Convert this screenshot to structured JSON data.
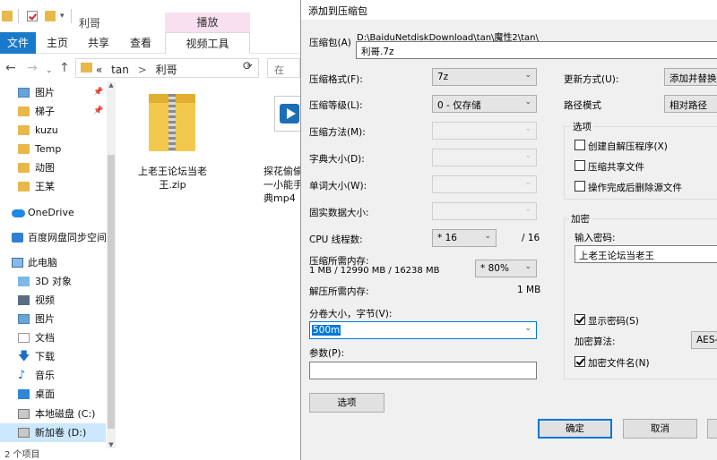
{
  "explorer": {
    "window_title": "利哥",
    "context_tab": "播放",
    "ribbon_tabs": [
      "文件",
      "主页",
      "共享",
      "查看",
      "视频工具"
    ],
    "address": {
      "prefix": "«",
      "segments": [
        "tan",
        "利哥"
      ],
      "separator": ">"
    },
    "search_placeholder": "在",
    "sidebar": {
      "quick_access": [
        {
          "label": "图片",
          "icon": "picture-icon",
          "pinned": true
        },
        {
          "label": "梯子",
          "icon": "folder-icon",
          "pinned": true
        },
        {
          "label": "kuzu",
          "icon": "folder-icon"
        },
        {
          "label": "Temp",
          "icon": "folder-icon"
        },
        {
          "label": "动图",
          "icon": "folder-icon"
        },
        {
          "label": "王某",
          "icon": "folder-icon"
        }
      ],
      "onedrive": "OneDrive",
      "baidu": "百度网盘同步空间",
      "this_pc": "此电脑",
      "pc_items": [
        {
          "label": "3D 对象",
          "icon": "3d-objects-icon"
        },
        {
          "label": "视频",
          "icon": "video-icon"
        },
        {
          "label": "图片",
          "icon": "picture-icon"
        },
        {
          "label": "文档",
          "icon": "document-icon"
        },
        {
          "label": "下载",
          "icon": "download-icon"
        },
        {
          "label": "音乐",
          "icon": "music-icon"
        },
        {
          "label": "桌面",
          "icon": "desktop-icon"
        },
        {
          "label": "本地磁盘 (C:)",
          "icon": "drive-icon"
        },
        {
          "label": "新加卷 (D:)",
          "icon": "drive-icon",
          "selected": true
        }
      ]
    },
    "files": [
      {
        "name_line1": "上老王论坛当老",
        "name_line2": "王.zip",
        "icon": "zip-icon"
      },
      {
        "name_line1": "探花偷偷",
        "name_line2": "一小能手",
        "name_line3": "典mp4",
        "icon": "video-file-icon"
      }
    ],
    "status": "2 个项目"
  },
  "dialog": {
    "title": "添加到压缩包",
    "archive_label": "压缩包(A)",
    "archive_path": "D:\\BaiduNetdiskDownload\\tan\\魔性2\\tan\\",
    "archive_name": "利哥.7z",
    "format_label": "压缩格式(F):",
    "format_value": "7z",
    "level_label": "压缩等级(L):",
    "level_value": "0 - 仅存储",
    "method_label": "压缩方法(M):",
    "dict_label": "字典大小(D):",
    "word_label": "单词大小(W):",
    "solid_label": "固实数据大小:",
    "cpu_label": "CPU 线程数:",
    "cpu_value": "* 16",
    "cpu_total": "/ 16",
    "mem_compress_label": "压缩所需内存:",
    "mem_compress_detail": "1 MB / 12990 MB / 16238 MB",
    "mem_percent": "* 80%",
    "mem_decompress_label": "解压所需内存:",
    "mem_decompress_value": "1 MB",
    "split_label": "分卷大小，字节(V):",
    "split_value": "500m",
    "params_label": "参数(P):",
    "params_value": "",
    "options_button": "选项",
    "update_label": "更新方式(U):",
    "update_value": "添加并替换文",
    "path_mode_label": "路径模式",
    "path_mode_value": "相对路径",
    "options_group": "选项",
    "opt_sfx": "创建自解压程序(X)",
    "opt_shared": "压缩共享文件",
    "opt_delete": "操作完成后删除源文件",
    "encrypt_group": "加密",
    "password_label": "输入密码:",
    "password_value": "上老王论坛当老王",
    "show_password": "显示密码(S)",
    "enc_method_label": "加密算法:",
    "enc_method_value": "AES-2",
    "encrypt_names": "加密文件名(N)",
    "ok_button": "确定",
    "cancel_button": "取消"
  },
  "colors": {
    "accent": "#0078d7",
    "file_tab": "#1979ca",
    "context_tab": "#f8e0f0",
    "folder": "#e8b84a"
  }
}
